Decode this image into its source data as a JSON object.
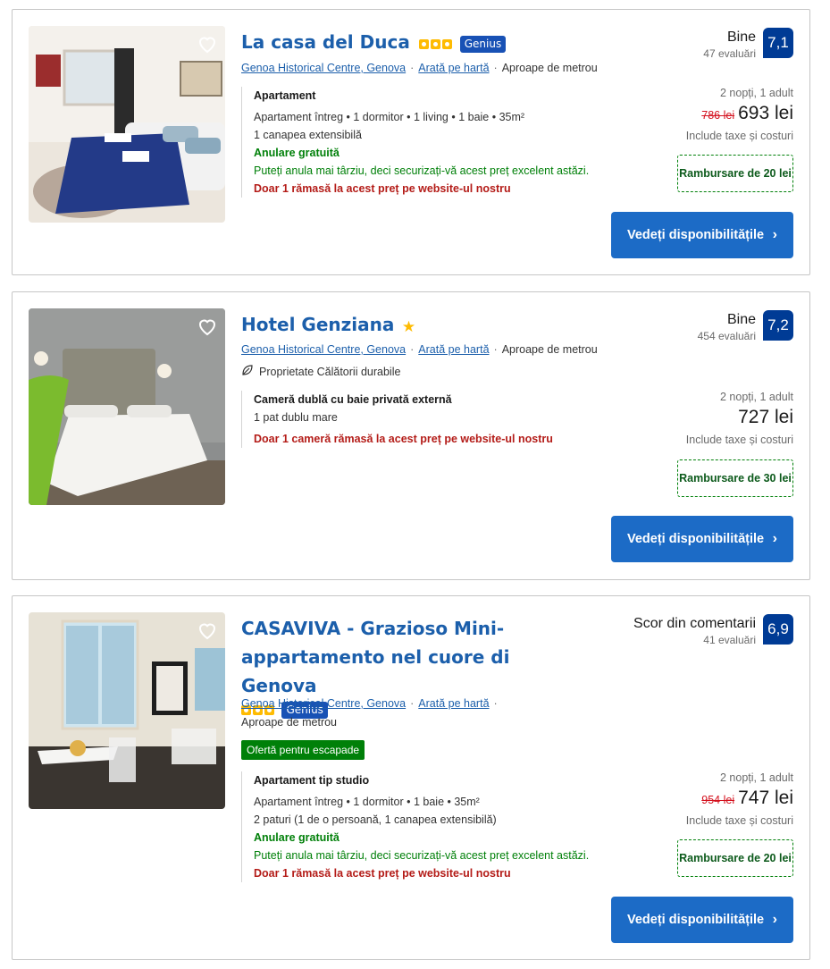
{
  "cards": [
    {
      "title": "La casa del Duca",
      "genius": "Genius",
      "location": {
        "area": "Genoa Historical Centre, Genova",
        "map": "Arată pe hartă",
        "metro": "Aproape de metrou"
      },
      "room": {
        "name": "Apartament",
        "details": "Apartament întreg • 1 dormitor • 1 living • 1 baie • 35m²",
        "beds": "1 canapea extensibilă",
        "free_cancel": "Anulare gratuită",
        "free_cancel_desc": "Puteți anula mai târziu, deci securizați-vă acest preț excelent astăzi.",
        "scarcity": "Doar 1 rămasă la acest preț pe website-ul nostru"
      },
      "review": {
        "word": "Bine",
        "count": "47 evaluări",
        "score": "7,1"
      },
      "price": {
        "nights": "2 nopți, 1 adult",
        "old": "786 lei",
        "now": "693 lei",
        "tax": "Include taxe și costuri"
      },
      "cashback": "Rambursare de 20 lei",
      "button": "Vedeți disponibilitățile"
    },
    {
      "title": "Hotel Genziana",
      "location": {
        "area": "Genoa Historical Centre, Genova",
        "map": "Arată pe hartă",
        "metro": "Aproape de metrou"
      },
      "sustainable": "Proprietate Călătorii durabile",
      "room": {
        "name": "Cameră dublă cu baie privată externă",
        "beds": "1 pat dublu mare",
        "scarcity": "Doar 1 cameră rămasă la acest preț pe website-ul nostru"
      },
      "review": {
        "word": "Bine",
        "count": "454 evaluări",
        "score": "7,2"
      },
      "price": {
        "nights": "2 nopți, 1 adult",
        "now": "727 lei",
        "tax": "Include taxe și costuri"
      },
      "cashback": "Rambursare de 30 lei",
      "button": "Vedeți disponibilitățile"
    },
    {
      "title": "CASAVIVA - Grazioso Mini-appartamento nel cuore di Genova",
      "genius": "Genius",
      "location": {
        "area": "Genoa Historical Centre, Genova",
        "map": "Arată pe hartă",
        "metro": "Aproape de metrou"
      },
      "offer": "Ofertă pentru escapade",
      "room": {
        "name": "Apartament tip studio",
        "details": "Apartament întreg • 1 dormitor • 1 baie • 35m²",
        "beds": "2 paturi (1 de o persoană, 1 canapea extensibilă)",
        "free_cancel": "Anulare gratuită",
        "free_cancel_desc": "Puteți anula mai târziu, deci securizați-vă acest preț excelent astăzi.",
        "scarcity": "Doar 1 rămasă la acest preț pe website-ul nostru"
      },
      "review": {
        "word": "Scor din comentarii",
        "count": "41 evaluări",
        "score": "6,9"
      },
      "price": {
        "nights": "2 nopți, 1 adult",
        "old": "954 lei",
        "now": "747 lei",
        "tax": "Include taxe și costuri"
      },
      "cashback": "Rambursare de 20 lei",
      "button": "Vedeți disponibilitățile"
    }
  ],
  "colors": {
    "link": "#1c5fab",
    "score_bg": "#003b95",
    "button_bg": "#1c6bc6",
    "genius_bg": "#1851b5",
    "green": "#008009",
    "red": "#b41c18",
    "star": "#febb02"
  },
  "icons": {
    "favorite": "heart-icon",
    "sustainable": "leaf-icon",
    "button": "chevron-right-icon",
    "rating": "star-icon"
  }
}
